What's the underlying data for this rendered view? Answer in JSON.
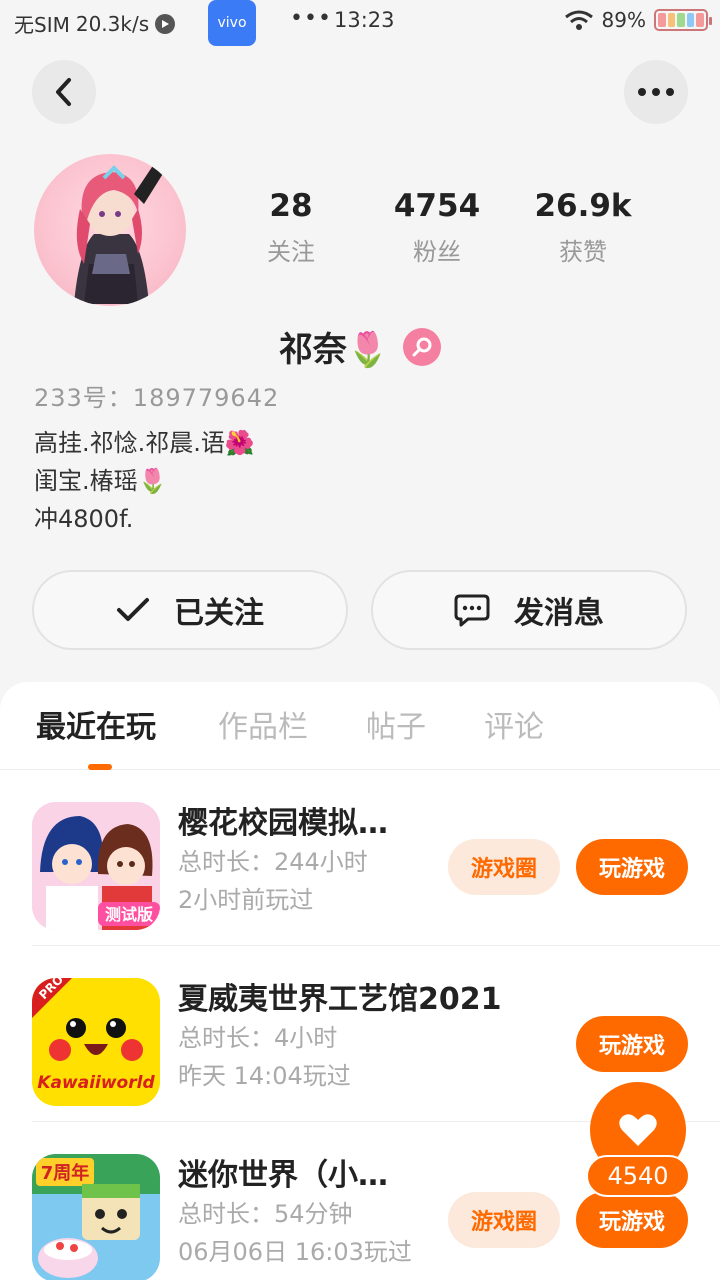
{
  "status_bar": {
    "carrier": "无SIM",
    "speed": "20.3k/s",
    "vivo_label": "vivo",
    "dots": "•••",
    "time": "13:23",
    "battery": "89%"
  },
  "profile": {
    "stats": [
      {
        "num": "28",
        "label": "关注"
      },
      {
        "num": "4754",
        "label": "粉丝"
      },
      {
        "num": "26.9k",
        "label": "获赞"
      }
    ],
    "nickname": "祁奈🌷",
    "uid": "233号：189779642",
    "bio": [
      "高挂.祁惗.祁晨.语🌺",
      "闺宝.椿瑶🌷",
      "冲4800f."
    ]
  },
  "actions": {
    "follow_label": "已关注",
    "message_label": "发消息"
  },
  "tabs": [
    {
      "label": "最近在玩"
    },
    {
      "label": "作品栏"
    },
    {
      "label": "帖子"
    },
    {
      "label": "评论"
    }
  ],
  "games": [
    {
      "title": "樱花校园模拟…",
      "duration": "总时长：244小时",
      "last_played": "2小时前玩过",
      "icon_badge": "测试版",
      "circle_label": "游戏圈",
      "play_label": "玩游戏"
    },
    {
      "title": "夏威夷世界工艺馆2021",
      "duration": "总时长：4小时",
      "last_played": "昨天 14:04玩过",
      "icon_badge": "Kawaiiworld",
      "icon_corner": "PRO",
      "play_label": "玩游戏"
    },
    {
      "title": "迷你世界（小…",
      "duration": "总时长：54分钟",
      "last_played": "06月06日 16:03玩过",
      "icon_badge": "7周年",
      "circle_label": "游戏圈",
      "play_label": "玩游戏"
    }
  ],
  "fab": {
    "count": "4540"
  },
  "colors": {
    "accent": "#ff6a00",
    "gender": "#f47fa0"
  }
}
